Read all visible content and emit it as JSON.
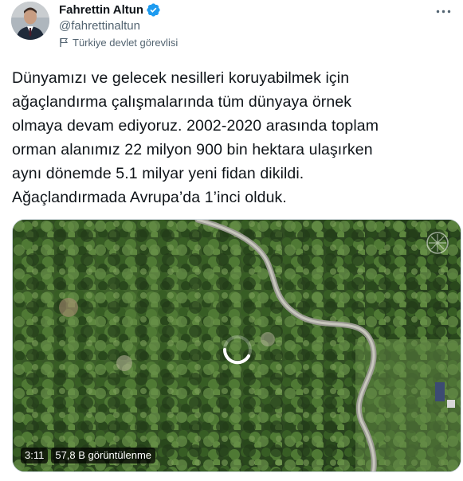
{
  "author": {
    "display_name": "Fahrettin Altun",
    "handle": "@fahrettinaltun",
    "affiliation": "Türkiye devlet görevlisi",
    "verified_icon": "verified-badge-icon"
  },
  "tweet": {
    "text": "Dünyamızı ve gelecek nesilleri koruyabilmek için\nağaçlandırma çalışmalarında tüm dünyaya örnek\nolmaya devam ediyoruz. 2002-2020 arasında toplam\norman alanımız 22 milyon 900 bin hektara ulaşırken\naynı dönemde 5.1 milyar yeni fidan dikildi.\nAğaçlandırmada Avrupa’da 1’inci olduk."
  },
  "video": {
    "duration": "3:11",
    "views": "57,8 B görüntülenme"
  },
  "colors": {
    "verified": "#1d9bf0",
    "secondary_text": "#536471",
    "primary_text": "#0f1419"
  }
}
